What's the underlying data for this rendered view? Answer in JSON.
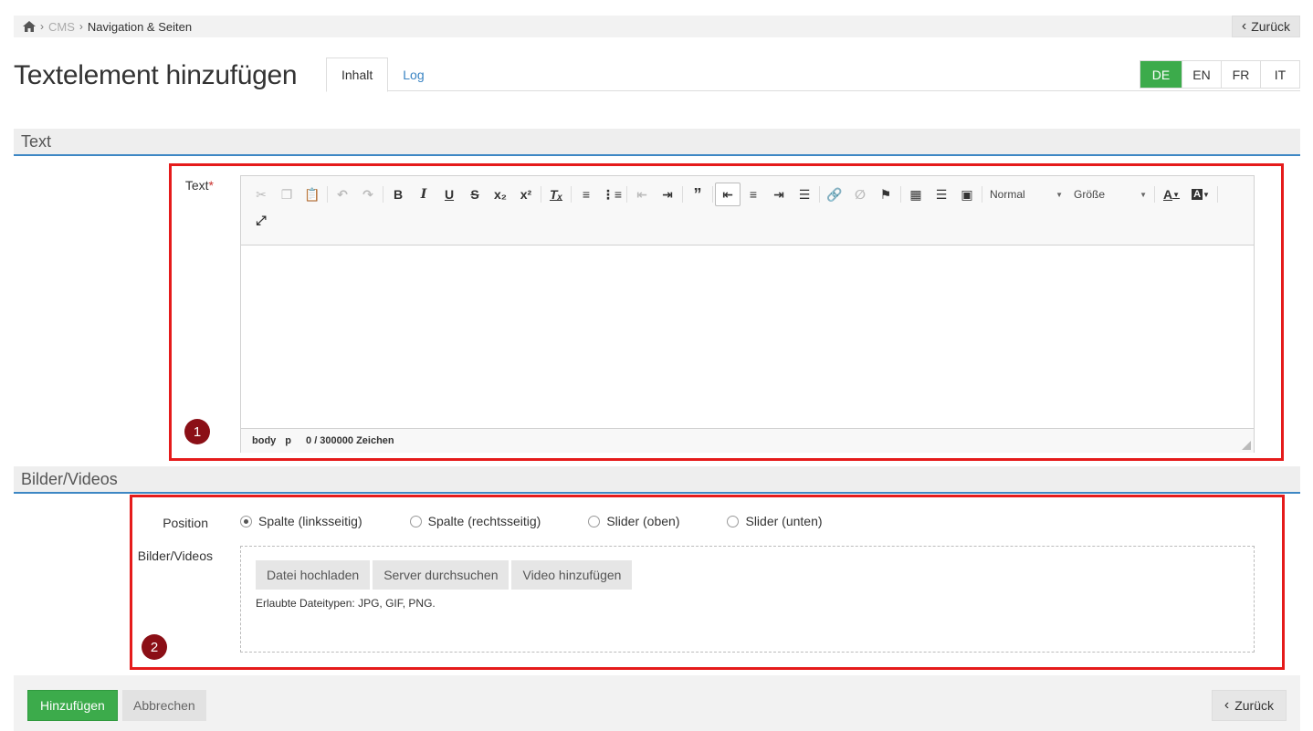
{
  "breadcrumb": {
    "home_icon": "home-icon",
    "items": [
      "CMS",
      "Navigation & Seiten"
    ],
    "back_label": "Zurück"
  },
  "page": {
    "title": "Textelement hinzufügen"
  },
  "tabs": [
    {
      "label": "Inhalt",
      "active": true
    },
    {
      "label": "Log",
      "active": false
    }
  ],
  "languages": [
    {
      "code": "DE",
      "active": true
    },
    {
      "code": "EN",
      "active": false
    },
    {
      "code": "FR",
      "active": false
    },
    {
      "code": "IT",
      "active": false
    }
  ],
  "sections": {
    "text": "Text",
    "media": "Bilder/Videos"
  },
  "text_field": {
    "label": "Text",
    "required_mark": "*"
  },
  "editor": {
    "format_combo": "Normal",
    "size_combo": "Größe",
    "status_path": [
      "body",
      "p"
    ],
    "char_count": "0 / 300000 Zeichen"
  },
  "markers": [
    "1",
    "2"
  ],
  "media": {
    "position_label": "Position",
    "position_options": [
      "Spalte (linksseitig)",
      "Spalte (rechtsseitig)",
      "Slider (oben)",
      "Slider (unten)"
    ],
    "selected_position": "Spalte (linksseitig)",
    "field_label": "Bilder/Videos",
    "buttons": [
      "Datei hochladen",
      "Server durchsuchen",
      "Video hinzufügen"
    ],
    "allowed_types": "Erlaubte Dateitypen: JPG, GIF, PNG."
  },
  "footer": {
    "submit_label": "Hinzufügen",
    "cancel_label": "Abbrechen",
    "back_label": "Zurück"
  },
  "colors": {
    "accent_green": "#3cab4b",
    "section_border": "#3d87c4",
    "annotation_red": "#e51b1b",
    "marker_red": "#8b0f16",
    "link_blue": "#3a84c3"
  }
}
